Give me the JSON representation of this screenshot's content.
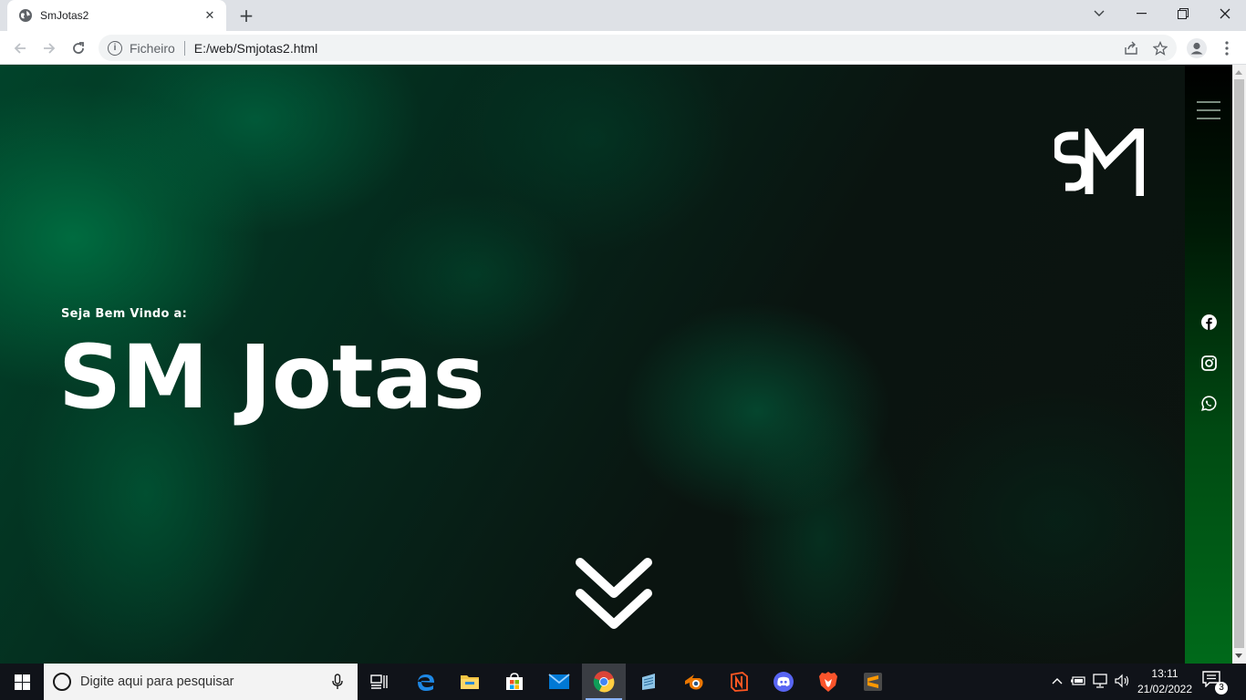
{
  "browser": {
    "tab_title": "SmJotas2",
    "tab_close": "✕",
    "new_tab": "+",
    "address_scheme": "Ficheiro",
    "address_url": "E:/web/Smjotas2.html",
    "icons": [
      "globe-icon",
      "back-icon",
      "forward-icon",
      "reload-icon",
      "info-icon",
      "share-icon",
      "star-icon",
      "profile-icon",
      "kebab-menu-icon",
      "tab-search-icon",
      "minimize-icon",
      "maximize-icon",
      "close-icon"
    ]
  },
  "page": {
    "welcome_text": "Seja Bem Vindo a:",
    "hero_title": "SM Jotas",
    "logo_text": "SM",
    "accent_color": "#006a1a",
    "social_icons": [
      "facebook-icon",
      "instagram-icon",
      "whatsapp-icon"
    ]
  },
  "taskbar": {
    "search_placeholder": "Digite aqui para pesquisar",
    "time": "13:11",
    "date": "21/02/2022",
    "notification_count": "3",
    "apps": [
      "task-view",
      "edge",
      "file-explorer",
      "microsoft-store",
      "mail",
      "chrome",
      "notepad",
      "blender",
      "notion",
      "discord",
      "brave",
      "sublime-text"
    ]
  }
}
